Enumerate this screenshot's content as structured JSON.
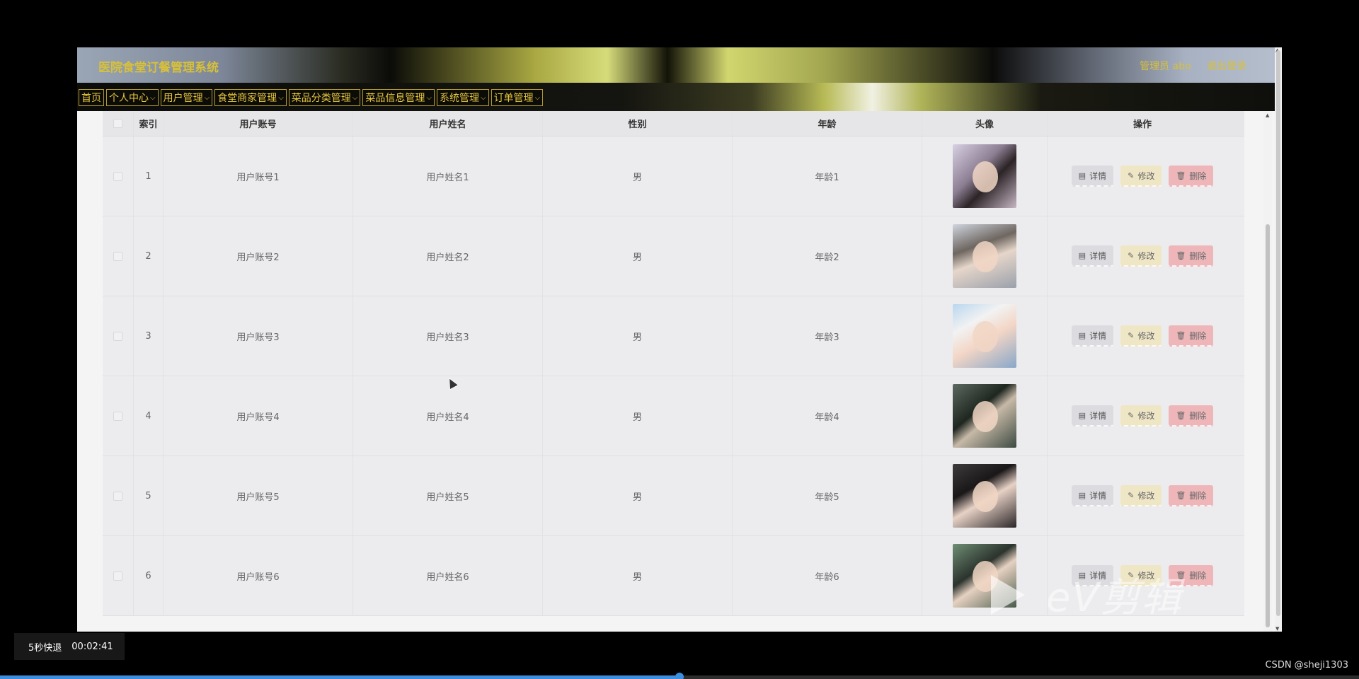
{
  "app": {
    "system_title": "医院食堂订餐管理系统",
    "user_label": "管理员 abo",
    "logout_label": "退出登录"
  },
  "nav": [
    {
      "label": "首页",
      "has_menu": false
    },
    {
      "label": "个人中心",
      "has_menu": true
    },
    {
      "label": "用户管理",
      "has_menu": true
    },
    {
      "label": "食堂商家管理",
      "has_menu": true
    },
    {
      "label": "菜品分类管理",
      "has_menu": true
    },
    {
      "label": "菜品信息管理",
      "has_menu": true
    },
    {
      "label": "系统管理",
      "has_menu": true
    },
    {
      "label": "订单管理",
      "has_menu": true
    }
  ],
  "table": {
    "headers": {
      "index": "索引",
      "account": "用户账号",
      "name": "用户姓名",
      "sex": "性别",
      "age": "年龄",
      "avatar": "头像",
      "ops": "操作"
    },
    "rows": [
      {
        "index": "1",
        "account": "用户账号1",
        "name": "用户姓名1",
        "sex": "男",
        "age": "年龄1"
      },
      {
        "index": "2",
        "account": "用户账号2",
        "name": "用户姓名2",
        "sex": "男",
        "age": "年龄2"
      },
      {
        "index": "3",
        "account": "用户账号3",
        "name": "用户姓名3",
        "sex": "男",
        "age": "年龄3"
      },
      {
        "index": "4",
        "account": "用户账号4",
        "name": "用户姓名4",
        "sex": "男",
        "age": "年龄4"
      },
      {
        "index": "5",
        "account": "用户账号5",
        "name": "用户姓名5",
        "sex": "男",
        "age": "年龄5"
      },
      {
        "index": "6",
        "account": "用户账号6",
        "name": "用户姓名6",
        "sex": "男",
        "age": "年龄6"
      }
    ],
    "actions": {
      "detail": "详情",
      "edit": "修改",
      "delete": "删除"
    }
  },
  "player": {
    "skip_label": "5秒快退",
    "timestamp": "00:02:41",
    "progress_fraction": 0.5,
    "watermark_text": "eV剪辑",
    "credit": "CSDN @sheji1303"
  },
  "colors": {
    "brand_gold": "#d8c038",
    "nav_border": "#b59c2c",
    "progress": "#3b8fe0"
  },
  "icons": {
    "detail": "document-icon",
    "edit": "pencil-icon",
    "delete": "trash-icon",
    "menu": "chevron-down-icon"
  }
}
